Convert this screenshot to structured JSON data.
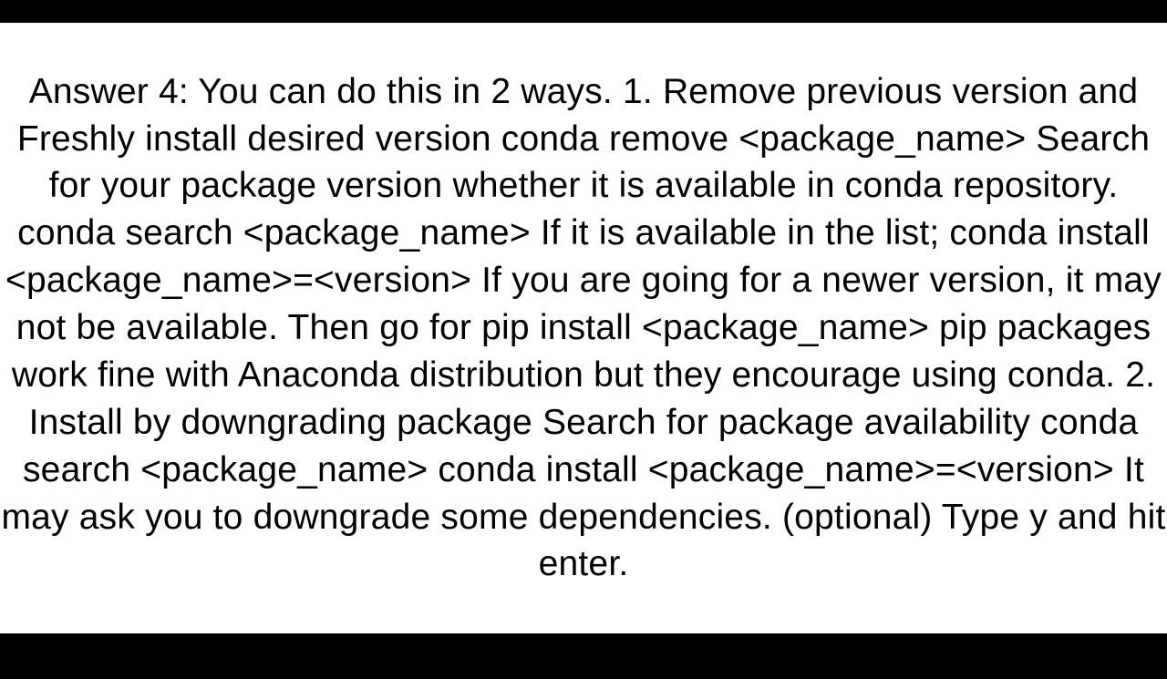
{
  "answer": {
    "text": "Answer 4: You can do this in 2 ways. 1. Remove previous version and Freshly install desired version conda remove <package_name>  Search for your package version whether it is available in conda repository. conda search <package_name>  If it is available in the list; conda install <package_name>=<version>  If you are going for a newer version, it may not be available. Then go for pip install <package_name> pip packages work fine with Anaconda distribution but they encourage using conda.  2. Install by downgrading package Search for package availability conda search <package_name>  conda install <package_name>=<version>  It may ask you to downgrade some dependencies. (optional) Type y and hit enter."
  }
}
